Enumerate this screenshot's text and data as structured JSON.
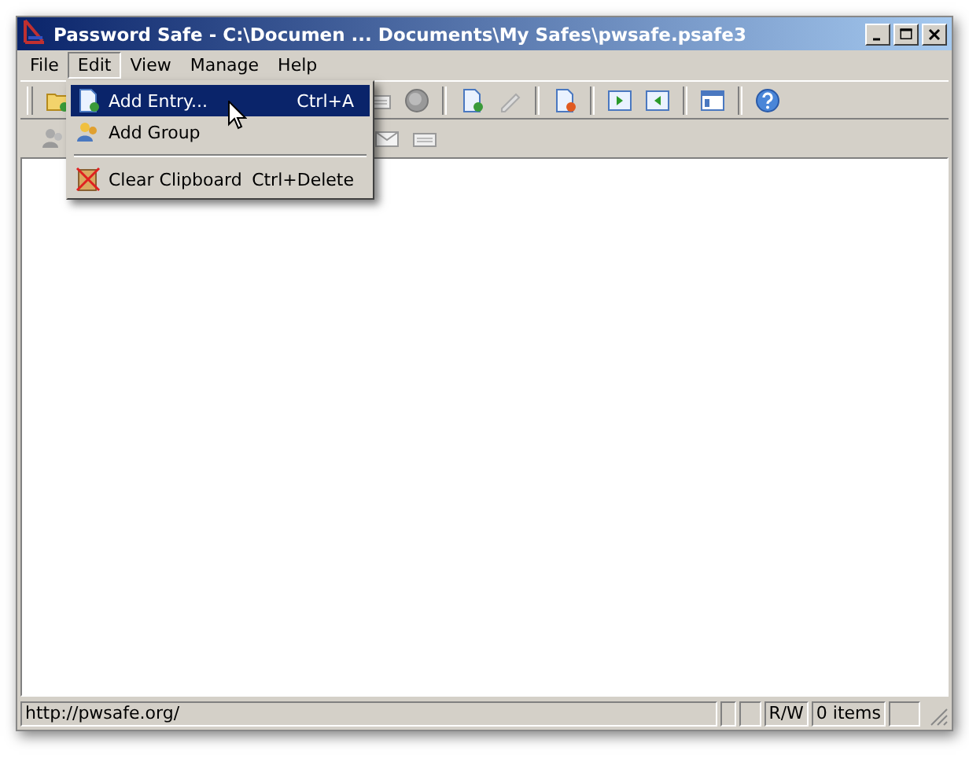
{
  "window": {
    "title": "Password Safe - C:\\Documen ... Documents\\My Safes\\pwsafe.psafe3"
  },
  "menu_bar": [
    {
      "label": "File",
      "selected": false
    },
    {
      "label": "Edit",
      "selected": true
    },
    {
      "label": "View",
      "selected": false
    },
    {
      "label": "Manage",
      "selected": false
    },
    {
      "label": "Help",
      "selected": false
    }
  ],
  "edit_menu": [
    {
      "kind": "item",
      "label": "Add Entry...",
      "shortcut": "Ctrl+A",
      "selected": true
    },
    {
      "kind": "item",
      "label": "Add Group",
      "selected": false
    },
    {
      "kind": "separator"
    },
    {
      "kind": "item",
      "label": "Clear Clipboard",
      "shortcut": "Ctrl+Delete",
      "selected": false
    }
  ],
  "status_bar": {
    "message": "http://pwsafe.org/",
    "panes": [
      "R/W",
      "0 items"
    ]
  }
}
